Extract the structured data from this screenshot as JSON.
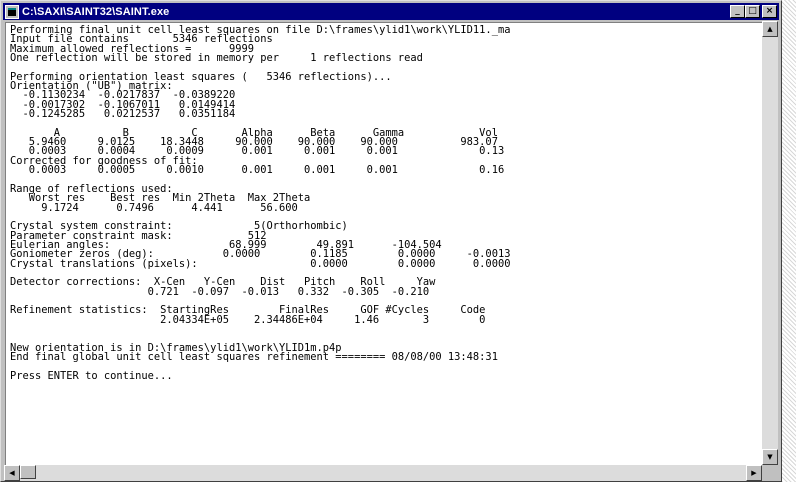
{
  "window": {
    "title": "C:\\SAXI\\SAINT32\\SAINT.exe",
    "buttons": {
      "minimize": "_",
      "maximize": "□",
      "close": "×"
    }
  },
  "console": {
    "lines": [
      "Performing final unit cell least squares on file D:\\frames\\ylid1\\work\\YLID11._ma",
      "Input file contains       5346 reflections",
      "Maximum allowed reflections =      9999",
      "One reflection will be stored in memory per     1 reflections read",
      "",
      "Performing orientation least squares (   5346 reflections)...",
      "Orientation (\"UB\") matrix:",
      "  -0.1130234  -0.0217837  -0.0389220",
      "  -0.0017302  -0.1067011   0.0149414",
      "  -0.1245285   0.0212537   0.0351184",
      "",
      "       A          B          C       Alpha      Beta      Gamma            Vol",
      "   5.9460     9.0125    18.3448     90.000    90.000    90.000          983.07",
      "   0.0003     0.0004     0.0009      0.001     0.001     0.001             0.13",
      "Corrected for goodness of fit:",
      "   0.0003     0.0005     0.0010      0.001     0.001     0.001             0.16",
      "",
      "Range of reflections used:",
      "   Worst res    Best res  Min 2Theta  Max 2Theta",
      "     9.1724      0.7496      4.441      56.600",
      "",
      "Crystal system constraint:             5(Orthorhombic)",
      "Parameter constraint mask:            512",
      "Eulerian angles:                   68.999        49.891      -104.504",
      "Goniometer zeros (deg):           0.0000        0.1185        0.0000     -0.0013",
      "Crystal translations (pixels):                  0.0000        0.0000      0.0000",
      "",
      "Detector corrections:  X-Cen   Y-Cen    Dist   Pitch    Roll     Yaw",
      "                      0.721  -0.097  -0.013   0.332  -0.305  -0.210",
      "",
      "Refinement statistics:  StartingRes        FinalRes     GOF #Cycles     Code",
      "                        2.04334E+05    2.34486E+04     1.46       3        0",
      "",
      "",
      "New orientation is in D:\\frames\\ylid1\\work\\YLID1m.p4p",
      "End final global unit cell least squares refinement ======== 08/08/00 13:48:31",
      "",
      "Press ENTER to continue...",
      ""
    ]
  },
  "scrollbars": {
    "vertical": {
      "up_arrow": "▲",
      "down_arrow": "▼"
    },
    "horizontal": {
      "left_arrow": "◀",
      "right_arrow": "▶"
    }
  }
}
